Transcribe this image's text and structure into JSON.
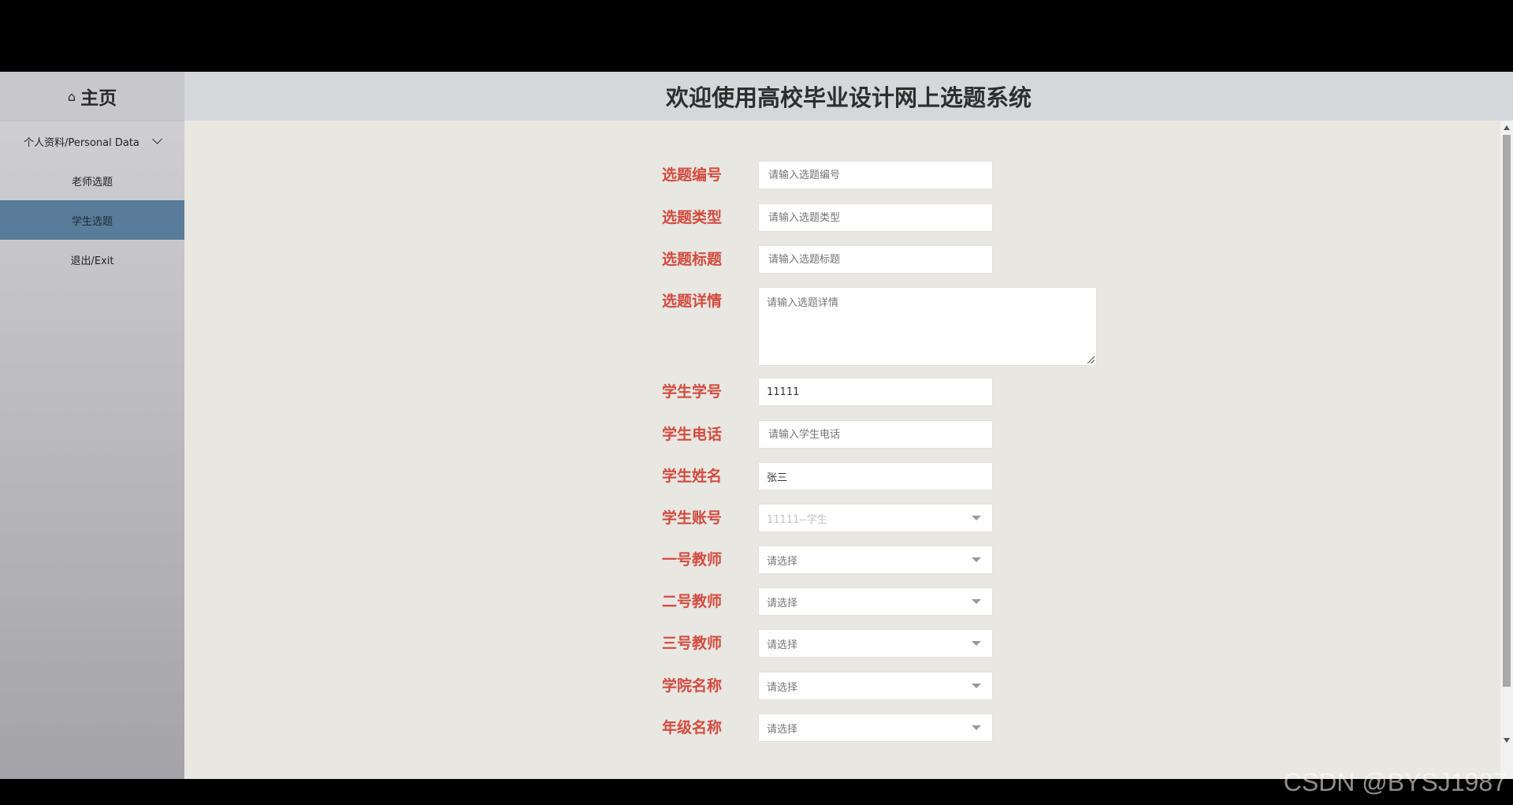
{
  "sidebar": {
    "home_label": "主页",
    "items": [
      {
        "label": "个人资料/Personal Data"
      },
      {
        "label": "老师选题"
      },
      {
        "label": "学生选题"
      },
      {
        "label": "退出/Exit"
      }
    ]
  },
  "header": {
    "title": "欢迎使用高校毕业设计网上选题系统"
  },
  "form": {
    "topic_no": {
      "label": "选题编号",
      "placeholder": "请输入选题编号"
    },
    "topic_type": {
      "label": "选题类型",
      "placeholder": "请输入选题类型"
    },
    "topic_title": {
      "label": "选题标题",
      "placeholder": "请输入选题标题"
    },
    "topic_detail": {
      "label": "选题详情",
      "placeholder": "请输入选题详情"
    },
    "student_id": {
      "label": "学生学号",
      "value": "11111"
    },
    "student_phone": {
      "label": "学生电话",
      "placeholder": "请输入学生电话"
    },
    "student_name": {
      "label": "学生姓名",
      "value": "张三"
    },
    "student_account": {
      "label": "学生账号",
      "value": "11111--学生"
    },
    "teacher1": {
      "label": "一号教师",
      "value": "请选择"
    },
    "teacher2": {
      "label": "二号教师",
      "value": "请选择"
    },
    "teacher3": {
      "label": "三号教师",
      "value": "请选择"
    },
    "college": {
      "label": "学院名称",
      "value": "请选择"
    },
    "grade": {
      "label": "年级名称",
      "value": "请选择"
    }
  },
  "watermark": "CSDN @BYSJ1987",
  "colors": {
    "label": "#d24b3f",
    "active_item": "#587c99"
  }
}
